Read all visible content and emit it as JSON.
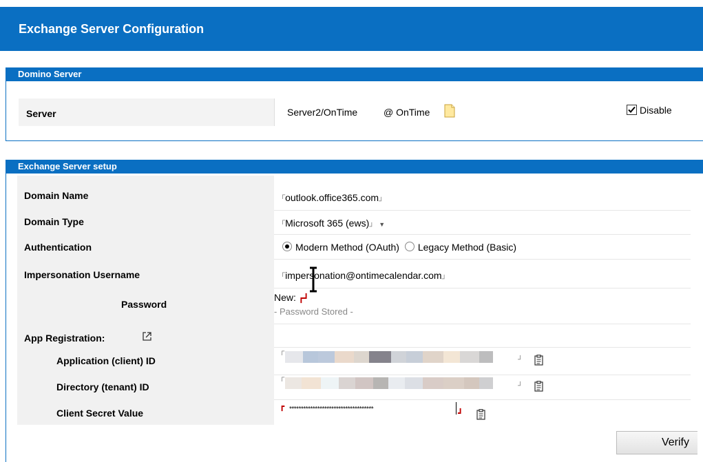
{
  "title": "Exchange Server Configuration",
  "domino": {
    "heading": "Domino Server",
    "label": "Server",
    "server": "Server2/OnTime",
    "at": "@ OnTime",
    "disable_label": "Disable",
    "disable_checked": true
  },
  "exchange": {
    "heading": "Exchange Server setup",
    "domain_name": {
      "label": "Domain Name",
      "value": "outlook.office365.com"
    },
    "domain_type": {
      "label": "Domain Type",
      "value": "Microsoft 365 (ews)"
    },
    "authentication": {
      "label": "Authentication",
      "options": [
        "Modern Method (OAuth)",
        "Legacy Method (Basic)"
      ],
      "selected": "Modern Method (OAuth)"
    },
    "impersonation": {
      "label": "Impersonation Username",
      "value": "impersonation@ontimecalendar.com"
    },
    "password": {
      "label": "Password",
      "new_label": "New:",
      "stored": "- Password Stored -"
    },
    "app_registration": {
      "label": "App Registration:"
    },
    "client_id": {
      "label": "Application (client) ID"
    },
    "tenant_id": {
      "label": "Directory (tenant) ID"
    },
    "client_secret": {
      "label": "Client Secret Value",
      "value": "************************************"
    }
  },
  "verify_label": "Verify",
  "icons": [
    "document-icon",
    "external-link-icon",
    "clipboard-icon",
    "text-cursor-icon",
    "dropdown-arrow-icon"
  ]
}
